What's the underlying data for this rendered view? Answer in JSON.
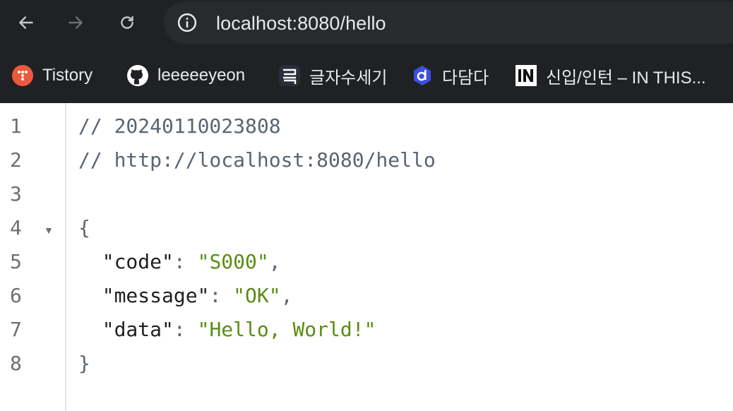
{
  "toolbar": {
    "back_icon": "arrow-left-icon",
    "forward_icon": "arrow-right-icon",
    "reload_icon": "reload-icon",
    "site_info_icon": "info-icon",
    "url": "localhost:8080/hello"
  },
  "bookmarks": [
    {
      "label": "Tistory",
      "icon": "tistory-icon"
    },
    {
      "label": "leeeeeyeon",
      "icon": "github-icon"
    },
    {
      "label": "글자수세기",
      "icon": "letter-count-icon"
    },
    {
      "label": "다담다",
      "icon": "dadamda-icon"
    },
    {
      "label": "신입/인턴 – IN THIS...",
      "icon": "inthis-icon"
    }
  ],
  "viewer": {
    "line_numbers": [
      "1",
      "2",
      "3",
      "4",
      "5",
      "6",
      "7",
      "8"
    ],
    "comment_timestamp": "// 20240110023808",
    "comment_url": "// http://localhost:8080/hello",
    "open_brace": "{",
    "close_brace": "}",
    "fields": [
      {
        "key": "\"code\"",
        "value": "\"S000\""
      },
      {
        "key": "\"message\"",
        "value": "\"OK\""
      },
      {
        "key": "\"data\"",
        "value": "\"Hello, World!\""
      }
    ],
    "fold_glyph": "▼"
  },
  "colors": {
    "toolbar_bg": "#202124",
    "omnibox_bg": "#282a2d",
    "string_green": "#5a8c12",
    "comment_gray": "#5b6470"
  }
}
